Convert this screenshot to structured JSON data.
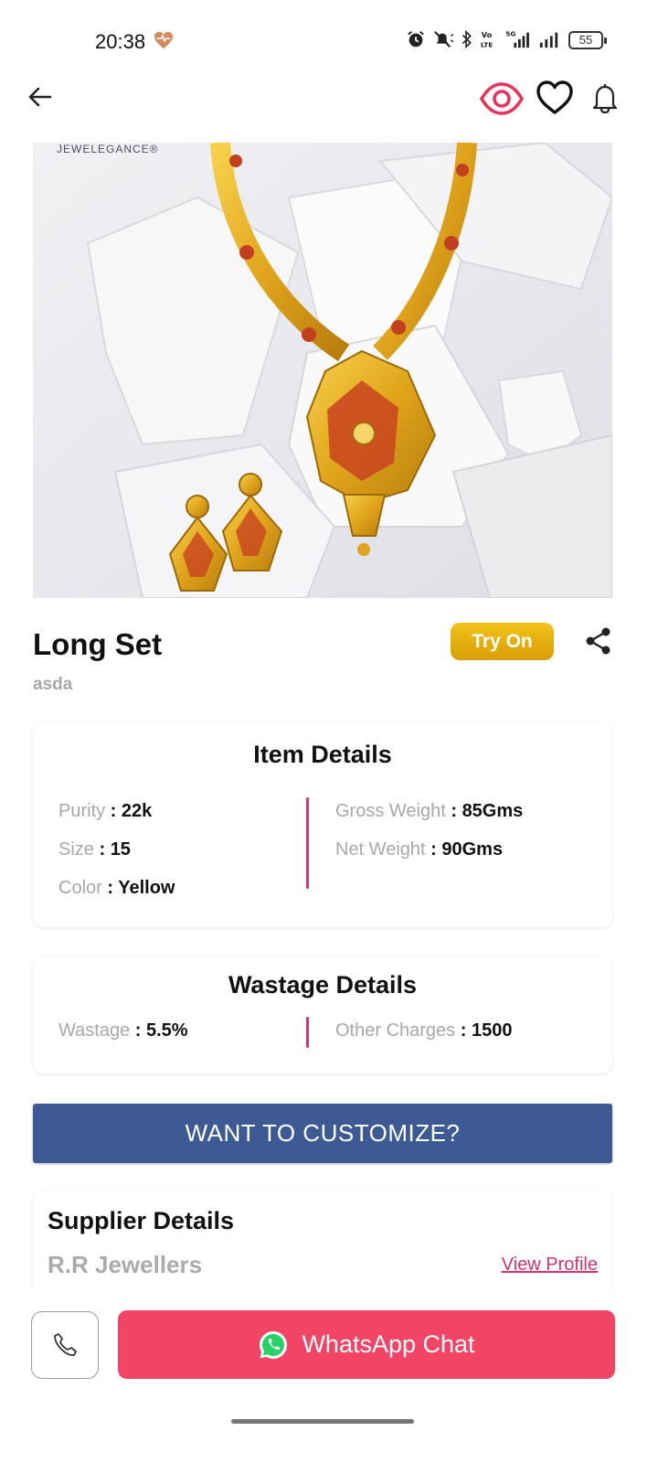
{
  "status_bar": {
    "time": "20:38",
    "battery": "55",
    "icons": [
      "heart-rate-icon",
      "alarm-icon",
      "mute-icon",
      "bluetooth-icon",
      "volte-icon",
      "5g-signal-icon",
      "signal-icon",
      "battery-icon"
    ]
  },
  "nav": {
    "icons": [
      "back-arrow-icon",
      "eye-icon",
      "heart-icon",
      "bell-icon"
    ],
    "eye_color": "#e8335a"
  },
  "product": {
    "image_brand": "JEWELEGANCE®",
    "title": "Long Set",
    "subtitle": "asda",
    "try_on_label": "Try On"
  },
  "item_details": {
    "title": "Item Details",
    "left": [
      {
        "label": "Purity",
        "value": "22k"
      },
      {
        "label": "Size",
        "value": "15"
      },
      {
        "label": "Color",
        "value": "Yellow"
      }
    ],
    "right": [
      {
        "label": "Gross Weight",
        "value": "85Gms"
      },
      {
        "label": "Net Weight",
        "value": "90Gms"
      }
    ]
  },
  "wastage_details": {
    "title": "Wastage Details",
    "left": [
      {
        "label": "Wastage",
        "value": "5.5%"
      }
    ],
    "right": [
      {
        "label": "Other Charges",
        "value": "1500"
      }
    ]
  },
  "customize_label": "WANT TO CUSTOMIZE?",
  "supplier": {
    "title": "Supplier Details",
    "name": "R.R Jewellers",
    "view_profile": "View Profile"
  },
  "bottom": {
    "whatsapp_label": "WhatsApp Chat",
    "accent": "#f24464"
  },
  "colors": {
    "accent_pink": "#d6336c",
    "customize_blue": "#3d5a95",
    "try_on_gold": "#e6ad0e"
  }
}
